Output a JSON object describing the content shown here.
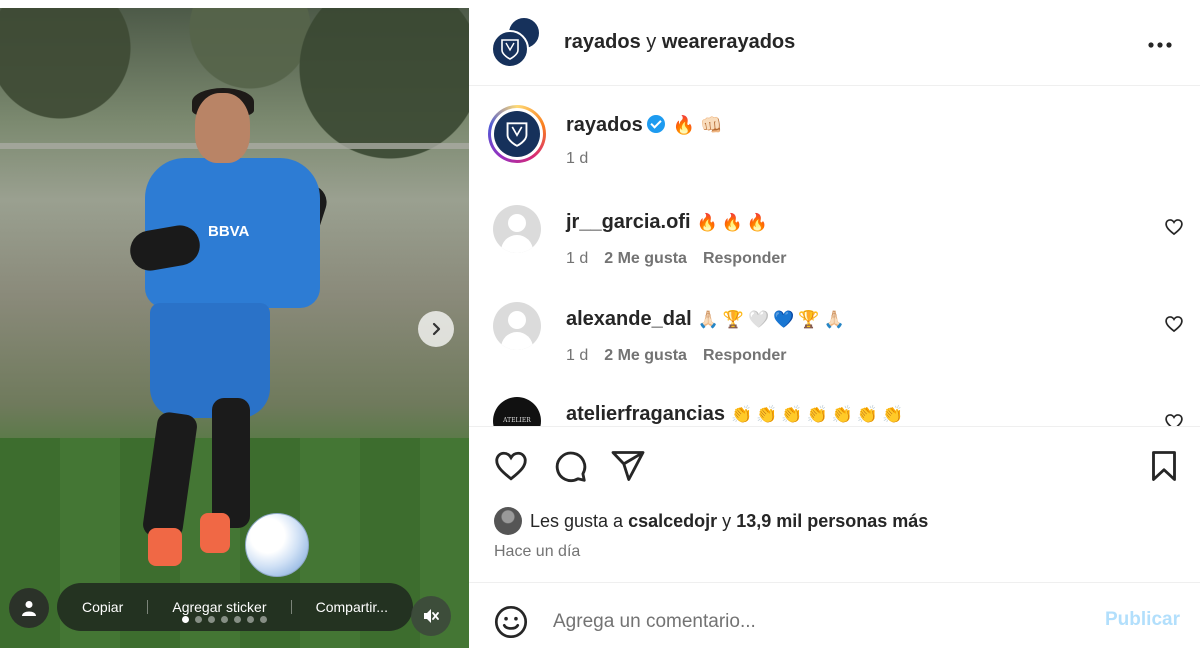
{
  "media": {
    "sponsor_text": "BBVA",
    "actions": [
      "Copiar",
      "Agregar sticker",
      "Compartir..."
    ],
    "carousel_dots": 7,
    "active_dot": 0
  },
  "header": {
    "user1": "rayados",
    "connector": "y",
    "user2": "wearerayados"
  },
  "caption": {
    "username": "rayados",
    "emojis": "🔥 👊🏻",
    "time": "1 d"
  },
  "comments": [
    {
      "username": "jr__garcia.ofi",
      "text": "🔥🔥🔥",
      "time": "1 d",
      "likes": "2 Me gusta",
      "reply": "Responder"
    },
    {
      "username": "alexande_dal",
      "text": "🙏🏻🏆🤍💙🏆🙏🏻",
      "time": "1 d",
      "likes": "2 Me gusta",
      "reply": "Responder"
    },
    {
      "username": "atelierfragancias",
      "text": "👏👏👏👏👏👏👏",
      "time": "",
      "likes": "",
      "reply": ""
    }
  ],
  "likes_line": {
    "prefix": "Les gusta a",
    "user": "csalcedojr",
    "connector": "y",
    "count": "13,9 mil personas más"
  },
  "posted_ago": "Hace un día",
  "composer": {
    "placeholder": "Agrega un comentario...",
    "publish_label": "Publicar"
  },
  "colors": {
    "accent_blue": "#0095f6",
    "publish_disabled": "#b2dffc",
    "verified": "#1d9bf0",
    "club_navy": "#16315b"
  },
  "icons": {
    "more": "more-horizontal-icon",
    "like": "heart-icon",
    "comment": "comment-icon",
    "share": "paper-plane-icon",
    "save": "bookmark-icon",
    "emoji": "smiley-icon",
    "next": "chevron-right-icon",
    "mute": "speaker-muted-icon",
    "user_tags": "user-icon"
  }
}
